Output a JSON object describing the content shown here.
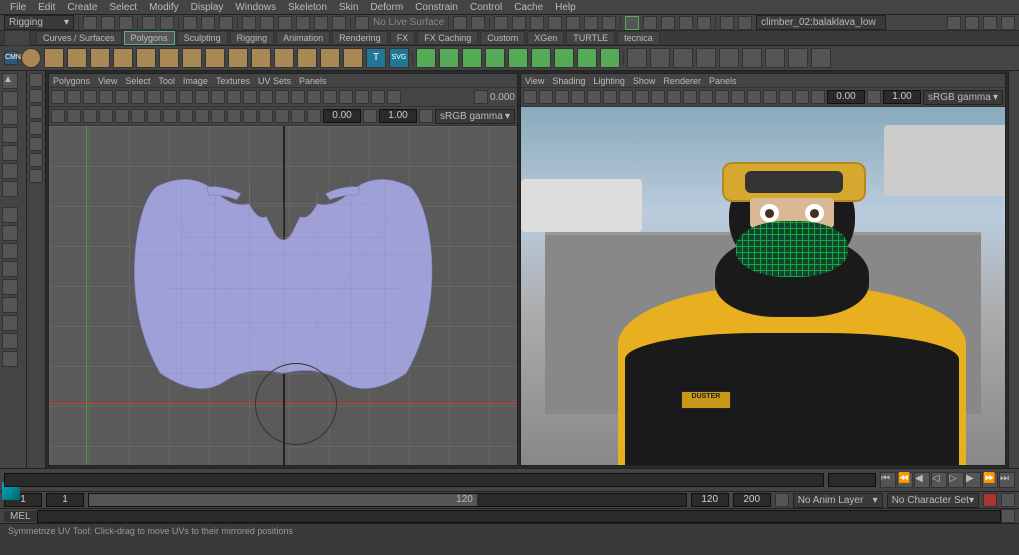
{
  "menubar": [
    "File",
    "Edit",
    "Create",
    "Select",
    "Modify",
    "Display",
    "Windows",
    "Skeleton",
    "Skin",
    "Deform",
    "Constrain",
    "Control",
    "Cache",
    "Help"
  ],
  "workspace": {
    "mode": "Rigging"
  },
  "statusline": {
    "live": "No Live Surface",
    "scene_name": "climber_02:balaklava_low"
  },
  "shelf_tabs": [
    "Curves / Surfaces",
    "Polygons",
    "Sculpting",
    "Rigging",
    "Animation",
    "Rendering",
    "FX",
    "FX Caching",
    "Custom",
    "XGen",
    "TURTLE",
    "tecnica"
  ],
  "active_shelf_tab": "Polygons",
  "uv_panel": {
    "menus": [
      "Polygons",
      "View",
      "Select",
      "Tool",
      "Image",
      "Textures",
      "UV Sets",
      "Panels"
    ],
    "exposure": "0.00",
    "gamma": "1.00",
    "color_space": "sRGB gamma"
  },
  "viewport_panel": {
    "menus": [
      "View",
      "Shading",
      "Lighting",
      "Show",
      "Renderer",
      "Panels"
    ],
    "exposure": "0.00",
    "gamma": "1.00",
    "color_space": "sRGB gamma",
    "stats": "0.000"
  },
  "timeline": {
    "start": "1",
    "range_start": "1",
    "current": "",
    "range_end": "120",
    "end": "120",
    "end2": "200",
    "anim_layer": "No Anim Layer",
    "char_set": "No Character Set"
  },
  "character": {
    "patch_label": "DUSTER"
  },
  "cmdline": {
    "lang": "MEL"
  },
  "helpline": "Symmetrize UV Tool: Click-drag to move UVs to their mirrored positions"
}
